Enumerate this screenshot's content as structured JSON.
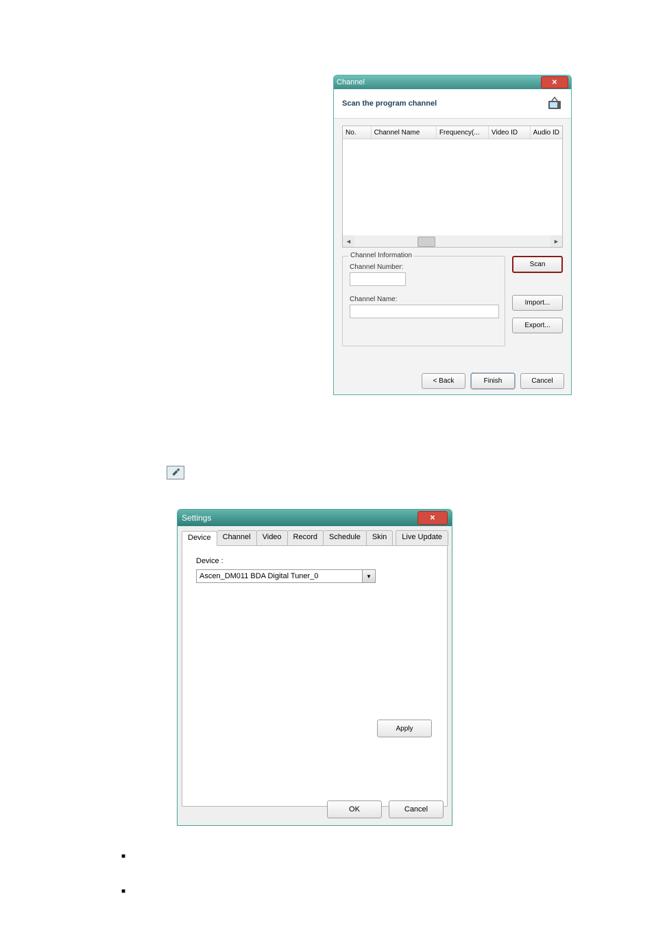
{
  "channel_dialog": {
    "title": "Channel",
    "header_title": "Scan the program channel",
    "columns": {
      "no": "No.",
      "channel_name": "Channel Name",
      "frequency": "Frequency(...",
      "video_id": "Video ID",
      "audio_id": "Audio ID"
    },
    "info_legend": "Channel Information",
    "channel_number_label": "Channel Number:",
    "channel_name_label": "Channel Name:",
    "scan_label": "Scan",
    "import_label": "Import...",
    "export_label": "Export...",
    "back_label": "< Back",
    "finish_label": "Finish",
    "cancel_label": "Cancel"
  },
  "settings_dialog": {
    "title": "Settings",
    "tabs": {
      "device": "Device",
      "channel": "Channel",
      "video": "Video",
      "record": "Record",
      "schedule": "Schedule",
      "skin": "Skin",
      "live_update": "Live Update"
    },
    "device_label": "Device :",
    "device_value": "Ascen_DM011 BDA Digital Tuner_0",
    "apply_label": "Apply",
    "ok_label": "OK",
    "cancel_label": "Cancel"
  },
  "bullets": {
    "b1": "■",
    "b2": "■"
  }
}
